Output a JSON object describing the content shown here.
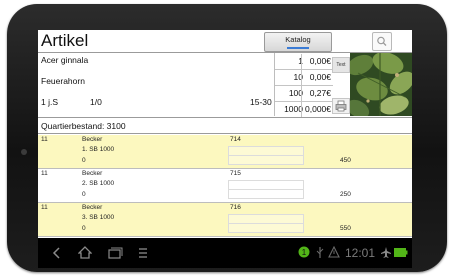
{
  "header": {
    "title": "Artikel",
    "tab_label": "Katalog",
    "search_icon": "search-icon"
  },
  "article": {
    "name": "Acer ginnala",
    "variety": "Feuerahorn",
    "age": "1 j.S",
    "ratio": "1/0",
    "size": "15-30"
  },
  "prices": [
    {
      "qty": "1",
      "price": "0,00€"
    },
    {
      "qty": "10",
      "price": "0,00€"
    },
    {
      "qty": "100",
      "price": "0,27€"
    },
    {
      "qty": "1000",
      "price": "0,000€"
    }
  ],
  "buttons": {
    "text": "Text",
    "print_icon": "printer-icon"
  },
  "stock": {
    "label": "Quartierbestand: 3100"
  },
  "rows": [
    {
      "num": "11",
      "name": "Becker",
      "sub": "1. SB 1000",
      "zero": "0",
      "code": "714",
      "amount": "450",
      "highlight": true
    },
    {
      "num": "11",
      "name": "Becker",
      "sub": "2. SB 1000",
      "zero": "0",
      "code": "715",
      "amount": "250",
      "highlight": false
    },
    {
      "num": "11",
      "name": "Becker",
      "sub": "3. SB 1000",
      "zero": "0",
      "code": "716",
      "amount": "550",
      "highlight": true
    }
  ],
  "statusbar": {
    "time": "12:01",
    "icons": [
      "back-icon",
      "home-icon",
      "recent-apps-icon",
      "menu-icon",
      "app-notification-icon",
      "usb-icon",
      "warning-icon",
      "airplane-icon",
      "battery-icon"
    ]
  },
  "colors": {
    "highlight_row": "#fcf8bf",
    "accent": "#3a7bd5",
    "status_green": "#52b518"
  }
}
